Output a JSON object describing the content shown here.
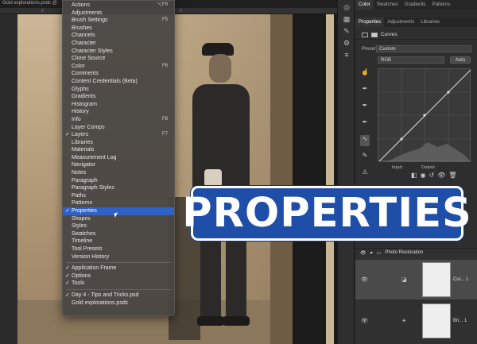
{
  "document": {
    "tab_title": "Gold explorations.psdc @",
    "ruler_marks": [
      "2",
      "4",
      "6"
    ]
  },
  "window_menu": {
    "items": [
      {
        "label": "Actions",
        "shortcut": "⌥F9",
        "checked": false
      },
      {
        "label": "Adjustments",
        "shortcut": "",
        "checked": false
      },
      {
        "label": "Brush Settings",
        "shortcut": "F5",
        "checked": false
      },
      {
        "label": "Brushes",
        "shortcut": "",
        "checked": false
      },
      {
        "label": "Channels",
        "shortcut": "",
        "checked": false
      },
      {
        "label": "Character",
        "shortcut": "",
        "checked": false
      },
      {
        "label": "Character Styles",
        "shortcut": "",
        "checked": false
      },
      {
        "label": "Clone Source",
        "shortcut": "",
        "checked": false
      },
      {
        "label": "Color",
        "shortcut": "F6",
        "checked": false
      },
      {
        "label": "Comments",
        "shortcut": "",
        "checked": false
      },
      {
        "label": "Content Credentials (Beta)",
        "shortcut": "",
        "checked": false
      },
      {
        "label": "Glyphs",
        "shortcut": "",
        "checked": false
      },
      {
        "label": "Gradients",
        "shortcut": "",
        "checked": false
      },
      {
        "label": "Histogram",
        "shortcut": "",
        "checked": false
      },
      {
        "label": "History",
        "shortcut": "",
        "checked": false
      },
      {
        "label": "Info",
        "shortcut": "F8",
        "checked": false
      },
      {
        "label": "Layer Comps",
        "shortcut": "",
        "checked": false
      },
      {
        "label": "Layers",
        "shortcut": "F7",
        "checked": true
      },
      {
        "label": "Libraries",
        "shortcut": "",
        "checked": false
      },
      {
        "label": "Materials",
        "shortcut": "",
        "checked": false
      },
      {
        "label": "Measurement Log",
        "shortcut": "",
        "checked": false
      },
      {
        "label": "Navigator",
        "shortcut": "",
        "checked": false
      },
      {
        "label": "Notes",
        "shortcut": "",
        "checked": false
      },
      {
        "label": "Paragraph",
        "shortcut": "",
        "checked": false
      },
      {
        "label": "Paragraph Styles",
        "shortcut": "",
        "checked": false
      },
      {
        "label": "Paths",
        "shortcut": "",
        "checked": false
      },
      {
        "label": "Patterns",
        "shortcut": "",
        "checked": false
      },
      {
        "label": "Properties",
        "shortcut": "",
        "checked": true,
        "selected": true
      },
      {
        "label": "Shapes",
        "shortcut": "",
        "checked": false
      },
      {
        "label": "Styles",
        "shortcut": "",
        "checked": false
      },
      {
        "label": "Swatches",
        "shortcut": "",
        "checked": false
      },
      {
        "label": "Timeline",
        "shortcut": "",
        "checked": false
      },
      {
        "label": "Tool Presets",
        "shortcut": "",
        "checked": false
      },
      {
        "label": "Version History",
        "shortcut": "",
        "checked": false
      }
    ],
    "group2": [
      {
        "label": "Application Frame",
        "checked": true
      },
      {
        "label": "Options",
        "checked": true
      },
      {
        "label": "Tools",
        "checked": true
      }
    ],
    "documents": [
      {
        "label": "Day 4 - Tips and Tricks.psd",
        "checked": true
      },
      {
        "label": "Gold explorations.psdc",
        "checked": false
      }
    ]
  },
  "panel": {
    "top_tabs": [
      "Color",
      "Swatches",
      "Gradients",
      "Patterns"
    ],
    "sub_tabs": [
      "Properties",
      "Adjustments",
      "Libraries"
    ],
    "props_title": "Curves",
    "preset_label": "Preset:",
    "preset_value": "Custom",
    "channel_value": "RGB",
    "auto_label": "Auto",
    "input_label": "Input:",
    "output_label": "Output:",
    "layers": {
      "group_name": "Photo Restoration",
      "rows": [
        {
          "name": "Cur... 1"
        },
        {
          "name": "Bri... 1"
        }
      ]
    }
  },
  "banner": {
    "text": "PROPERTIES",
    "color": "#1f4ea8"
  },
  "colors": {
    "menu_selected": "#2f62c9",
    "banner_bg": "#1f4ea8"
  }
}
